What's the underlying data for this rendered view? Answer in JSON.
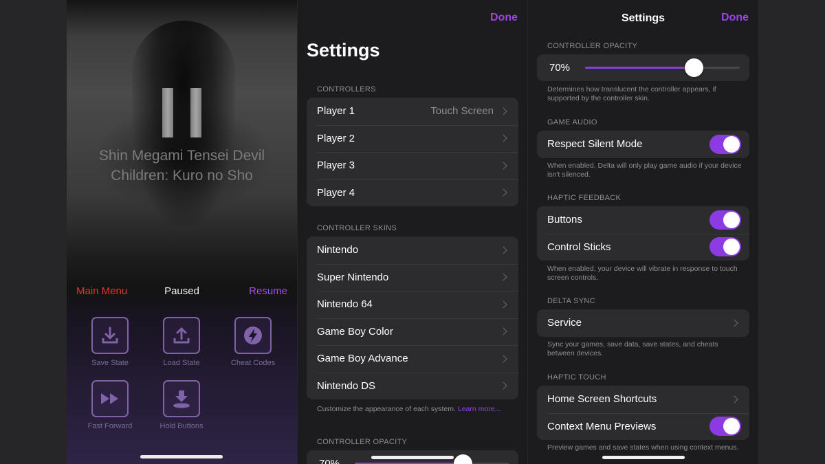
{
  "pause_screen": {
    "game_title_line1": "Shin Megami Tensei Devil",
    "game_title_line2": "Children: Kuro no Sho",
    "main_menu_label": "Main Menu",
    "status_label": "Paused",
    "resume_label": "Resume",
    "actions": [
      {
        "label": "Save State",
        "icon": "download-icon"
      },
      {
        "label": "Load State",
        "icon": "upload-icon"
      },
      {
        "label": "Cheat Codes",
        "icon": "lightning-icon"
      },
      {
        "label": "Fast Forward",
        "icon": "fast-forward-icon"
      },
      {
        "label": "Hold Buttons",
        "icon": "hold-button-icon"
      }
    ]
  },
  "settings_main": {
    "done_label": "Done",
    "title": "Settings",
    "controllers_header": "CONTROLLERS",
    "controllers": [
      {
        "label": "Player 1",
        "value": "Touch Screen"
      },
      {
        "label": "Player 2",
        "value": ""
      },
      {
        "label": "Player 3",
        "value": ""
      },
      {
        "label": "Player 4",
        "value": ""
      }
    ],
    "skins_header": "CONTROLLER SKINS",
    "skins": [
      "Nintendo",
      "Super Nintendo",
      "Nintendo 64",
      "Game Boy Color",
      "Game Boy Advance",
      "Nintendo DS"
    ],
    "skins_footer": "Customize the appearance of each system.",
    "skins_footer_link": "Learn more...",
    "opacity_header": "CONTROLLER OPACITY",
    "opacity_value": "70%"
  },
  "settings_scrolled": {
    "nav_title": "Settings",
    "done_label": "Done",
    "opacity_header": "CONTROLLER OPACITY",
    "opacity_value": "70%",
    "opacity_fraction": 0.7,
    "opacity_footer": "Determines how translucent the controller appears, if supported by the controller skin.",
    "audio_header": "GAME AUDIO",
    "respect_silent_label": "Respect Silent Mode",
    "respect_silent_on": true,
    "audio_footer": "When enabled, Delta will only play game audio if your device isn't silenced.",
    "haptic_header": "HAPTIC FEEDBACK",
    "haptic_buttons_label": "Buttons",
    "haptic_sticks_label": "Control Sticks",
    "haptic_footer": "When enabled, your device will vibrate in response to touch screen controls.",
    "sync_header": "DELTA SYNC",
    "service_label": "Service",
    "sync_footer": "Sync your games, save data, save states, and cheats between devices.",
    "touch_header": "HAPTIC TOUCH",
    "home_shortcuts_label": "Home Screen Shortcuts",
    "context_previews_label": "Context Menu Previews",
    "touch_footer": "Preview games and save states when using context menus."
  },
  "colors": {
    "accent": "#9b43e6",
    "destructive": "#e3342f",
    "group_bg": "#2c2c2e",
    "panel_bg": "#1c1c1e"
  }
}
